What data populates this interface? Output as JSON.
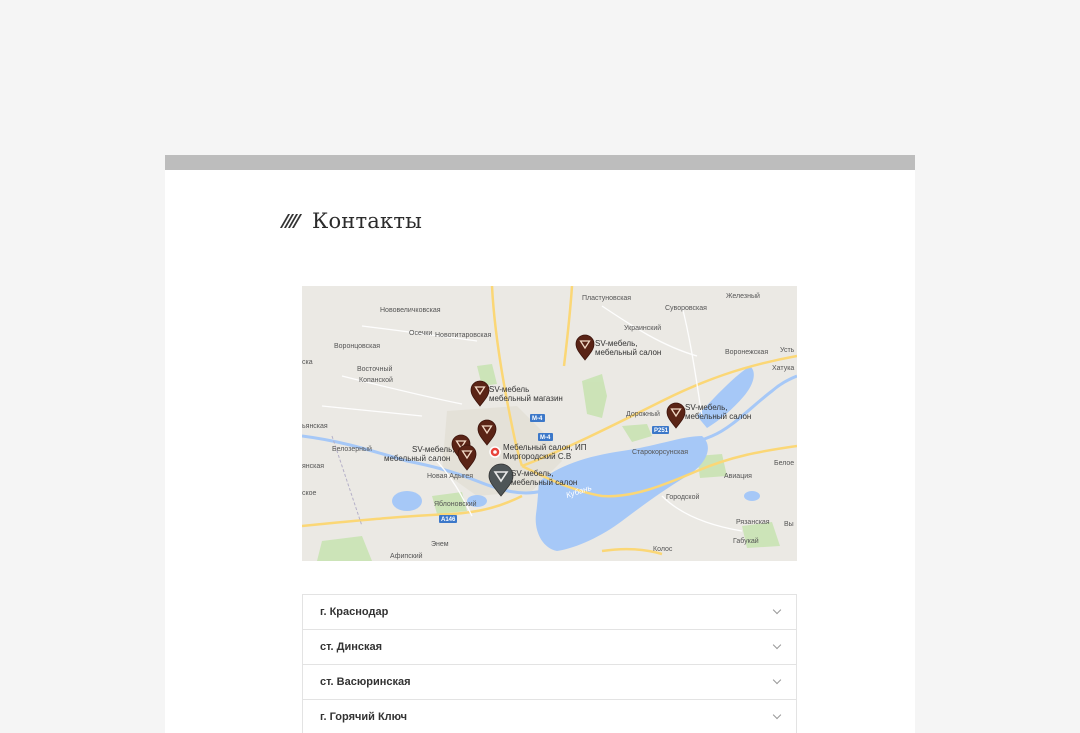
{
  "page": {
    "title": "Контакты"
  },
  "map": {
    "places": {
      "novovelichkovskaya": "Нововеличковская",
      "plastunovskaya": "Пластуновская",
      "suvorovskaya": "Суворовская",
      "zhelezny": "Железный",
      "osechki": "Осечки",
      "novotitarovskaya": "Новотитаровская",
      "ukrainsky": "Украинский",
      "vorontsovskaya": "Воронцовская",
      "voronezhskaya": "Воронежская",
      "ust": "Усть",
      "khatuka": "Хатука",
      "vostochny": "Восточный",
      "kopanskoy": "Копанской",
      "dorozhny": "Дорожный",
      "belozerny": "Белозерный",
      "starokorsunskaya": "Старокорсунская",
      "beloe": "Белое",
      "novaya_adygeya": "Новая Адыгея",
      "aviatsiya": "Авиация",
      "gorodskoy": "Городской",
      "yablonovsky": "Яблоновский",
      "ryazanskaya": "Рязанская",
      "enem": "Энем",
      "gabukay": "Габукай",
      "kolos": "Колос",
      "afipsky": "Афипский",
      "kuban": "Кубань",
      "left_ska": "ска",
      "left_yanskaya": "ьянская",
      "left_yanskaya2": "янская",
      "left_oe": "ское",
      "right_vy": "Вы"
    },
    "roads": {
      "m4a": "М-4",
      "m4b": "М-4",
      "r251": "Р251",
      "a146": "А146"
    },
    "markers": {
      "m1_line1": "SV-мебель,",
      "m1_line2": "мебельный салон",
      "m2_line1": "SV-мебель",
      "m2_line2": "мебельный магазин",
      "m3_line1": "SV-мебель,",
      "m3_line2": "мебельный салон",
      "m4_line1": "SV-мебель,",
      "m4_line2": "мебельный салон",
      "m5_line1": "Мебельный салон, ИП",
      "m5_line2": "Миргородский С.В",
      "m6_line1": "SV-мебель,",
      "m6_line2": "мебельный салон"
    }
  },
  "cities": [
    {
      "label": "г. Краснодар"
    },
    {
      "label": "ст. Динская"
    },
    {
      "label": "ст. Васюринская"
    },
    {
      "label": "г. Горячий Ключ"
    }
  ]
}
